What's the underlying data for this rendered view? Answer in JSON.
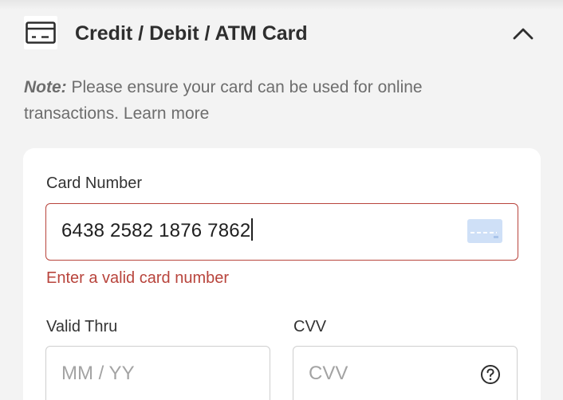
{
  "section": {
    "title": "Credit / Debit / ATM Card",
    "card_icon": "credit-card-icon",
    "collapse_icon": "chevron-up-icon"
  },
  "note": {
    "prefix": "Note:",
    "text": " Please ensure your card can be used for online transactions. ",
    "link": "Learn more"
  },
  "form": {
    "card_number": {
      "label": "Card Number",
      "value": "6438 2582 1876 7862",
      "error": "Enter a valid card number",
      "brand_icon": "generic-card-icon"
    },
    "valid_thru": {
      "label": "Valid Thru",
      "placeholder": "MM / YY",
      "value": ""
    },
    "cvv": {
      "label": "CVV",
      "placeholder": "CVV",
      "value": "",
      "help_icon": "question-circle-icon"
    }
  },
  "colors": {
    "background": "#f3f3f3",
    "panel": "#ffffff",
    "error": "#b8443c",
    "card_icon_tint": "#cfe0f7"
  }
}
